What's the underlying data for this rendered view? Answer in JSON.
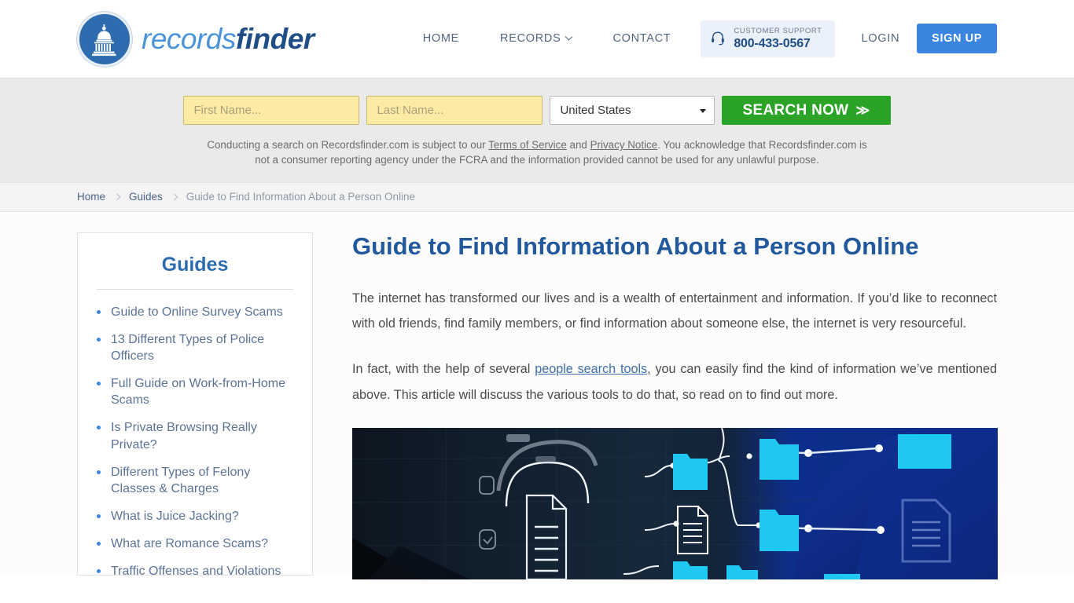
{
  "header": {
    "logo": {
      "part1": "records",
      "part2": "finder",
      "icon": "capitol-dome-icon"
    },
    "nav": [
      {
        "label": "HOME",
        "name": "nav-home"
      },
      {
        "label": "RECORDS",
        "name": "nav-records",
        "has_dropdown": true
      },
      {
        "label": "CONTACT",
        "name": "nav-contact"
      }
    ],
    "support": {
      "icon": "headset-icon",
      "label": "CUSTOMER SUPPORT",
      "phone": "800-433-0567"
    },
    "login_label": "LOGIN",
    "signup_label": "SIGN UP",
    "accent_blue": "#3b85e0"
  },
  "search": {
    "first_name_placeholder": "First Name...",
    "first_name_value": "",
    "last_name_placeholder": "Last Name...",
    "last_name_value": "",
    "country_selected": "United States",
    "country_options": [
      "United States"
    ],
    "button_label": "SEARCH NOW",
    "button_chevrons": "≫",
    "button_color": "#2ba327",
    "input_color": "#fbeba4",
    "disclaimer": {
      "text_1": "Conducting a search on Recordsfinder.com is subject to our ",
      "link_1": "Terms of Service",
      "text_2": " and ",
      "link_2": "Privacy Notice",
      "text_3": ". You acknowledge that Recordsfinder.com is not a consumer reporting agency under the FCRA and the information provided cannot be used for any unlawful purpose."
    }
  },
  "breadcrumb": [
    {
      "label": "Home",
      "current": false
    },
    {
      "label": "Guides",
      "current": false
    },
    {
      "label": "Guide to Find Information About a Person Online",
      "current": true
    }
  ],
  "sidebar": {
    "title": "Guides",
    "items": [
      {
        "label": "Guide to Online Survey Scams"
      },
      {
        "label": "13 Different Types of Police Officers"
      },
      {
        "label": "Full Guide on Work-from-Home Scams"
      },
      {
        "label": "Is Private Browsing Really Private?"
      },
      {
        "label": "Different Types of Felony Classes & Charges"
      },
      {
        "label": "What is Juice Jacking?"
      },
      {
        "label": "What are Romance Scams?"
      },
      {
        "label": "Traffic Offenses and Violations"
      }
    ]
  },
  "article": {
    "title": "Guide to Find Information About a Person Online",
    "paragraph_1": "The internet has transformed our lives and is a wealth of entertainment and information.  If you’d like to reconnect with old friends, find family members, or find information about someone else, the internet is very resourceful.",
    "paragraph_2_part1": "In fact, with the help of several ",
    "paragraph_2_link": "people search tools",
    "paragraph_2_part2": ", you can easily find the kind of information we’ve mentioned above. This article will discuss the various tools to do that, so read on to find out more.",
    "hero_image_alt": "digital document and folder network on dark screen"
  }
}
